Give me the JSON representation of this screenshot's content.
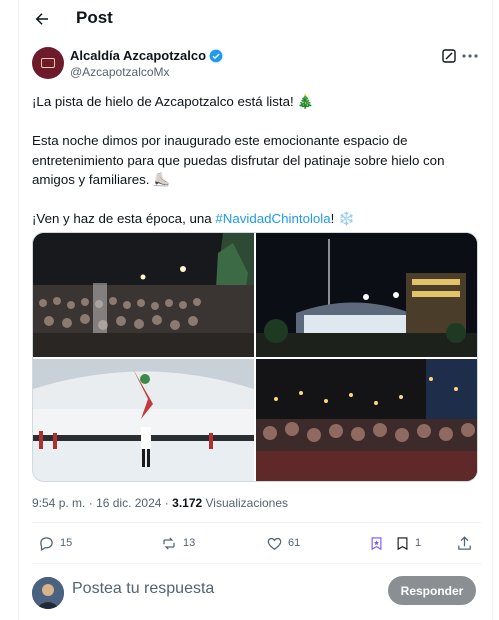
{
  "header": {
    "title": "Post"
  },
  "author": {
    "name": "Alcaldía Azcapotzalco",
    "handle": "@AzcapotzalcoMx"
  },
  "post": {
    "line1": "¡La pista de hielo de Azcapotzalco está lista! 🎄",
    "line2": "Esta noche dimos por inaugurado este emocionante espacio de entretenimiento para que puedas disfrutar del patinaje sobre hielo con amigos y familiares. ⛸️",
    "line3_prefix": "¡Ven y haz de esta época, una ",
    "hashtag": "#NavidadChintolola",
    "line3_suffix": "! ❄️"
  },
  "meta": {
    "time": "9:54 p. m.",
    "dot": "·",
    "date": "16 dic. 2024",
    "views_count": "3.172",
    "views_label": "Visualizaciones"
  },
  "actions": {
    "replies": "15",
    "reposts": "13",
    "likes": "61",
    "bookmarks": "1"
  },
  "reply": {
    "placeholder": "Postea tu respuesta",
    "button": "Responder"
  },
  "colors": {
    "link": "#1d9bf0",
    "verified": "#1d9bf0",
    "muted": "#536471",
    "button_disabled": "#8a8f93"
  }
}
